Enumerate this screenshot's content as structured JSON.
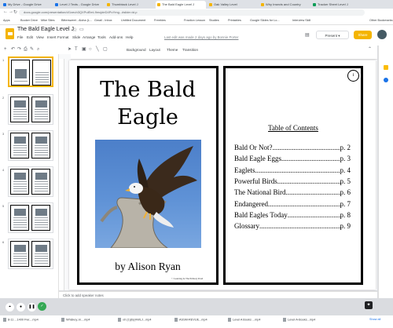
{
  "browser": {
    "tabs": [
      {
        "label": "My Drive - Google Drive",
        "active": false,
        "color": "#1a73e8"
      },
      {
        "label": "Level J Texts - Google Drive",
        "active": false,
        "color": "#1a73e8"
      },
      {
        "label": "Thumbtack Level J",
        "active": false,
        "color": "#f4b400"
      },
      {
        "label": "The Bald Eagle Level J",
        "active": true,
        "color": "#f4b400"
      },
      {
        "label": "Oak Valley Level",
        "active": false,
        "color": "#f4b400"
      },
      {
        "label": "Why Insects and Country",
        "active": false,
        "color": "#f4b400"
      },
      {
        "label": "Tracker Sheet Level J",
        "active": false,
        "color": "#0f9d58"
      }
    ],
    "url": "docs.google.com/presentation/d/1xeuh3QXPulEml-9mcjdeD4PoYmg...#slide=id.p",
    "bookmarks": [
      "Apps",
      "Booker Drive",
      "Mike Sites",
      "Bittersweet - Aloha (L...",
      "Gmail - Inbox",
      "Untitled Document",
      "Freebies",
      "Fraction Lesson",
      "Studies",
      "Printables",
      "Google Slides for Lo...",
      "Interview Skill",
      "Other Bookmarks"
    ]
  },
  "app": {
    "title": "The Bald Eagle Level J",
    "menus": [
      "File",
      "Edit",
      "View",
      "Insert",
      "Format",
      "Slide",
      "Arrange",
      "Tools",
      "Add-ons",
      "Help"
    ],
    "last_edit": "Last edit was made 2 days ago by Bonnie Porter",
    "present_label": "Present",
    "share_label": "Share"
  },
  "toolbar": {
    "items": [
      "Background",
      "Layout",
      "Theme",
      "Transition"
    ]
  },
  "filmstrip": {
    "slide_numbers": [
      "1",
      "2",
      "3",
      "4",
      "5",
      "6"
    ],
    "selected": 1
  },
  "slide": {
    "book_title": "The Bald Eagle",
    "author": "by Alison Ryan",
    "credit": "© Learning At The Primary Pond",
    "page_number": "i",
    "toc_heading": "Table of Contents",
    "toc": [
      {
        "title": "Bald Or Not?",
        "page": "p. 2"
      },
      {
        "title": "Bald Eagle Eggs",
        "page": "p. 3"
      },
      {
        "title": "Eaglets",
        "page": "p. 4"
      },
      {
        "title": "Powerful Birds",
        "page": "p. 5"
      },
      {
        "title": "The National Bird",
        "page": "p. 6"
      },
      {
        "title": "Endangered",
        "page": "p. 7"
      },
      {
        "title": "Bald Eagles Today",
        "page": "p. 8"
      },
      {
        "title": "Glossary",
        "page": "p. 9"
      }
    ]
  },
  "notes": {
    "placeholder": "Click to add speaker notes"
  },
  "downloads": {
    "files": [
      "8-11 ...1400 Fwr....mp4",
      "Whiskey..ki....mp4",
      "x0 (1)(b)(HWLJ...mp4",
      "ASSM-REVUE...mp4",
      "Level A Books ...mp4",
      "Level-A-Books...mp4"
    ],
    "show_all": "Show all"
  }
}
